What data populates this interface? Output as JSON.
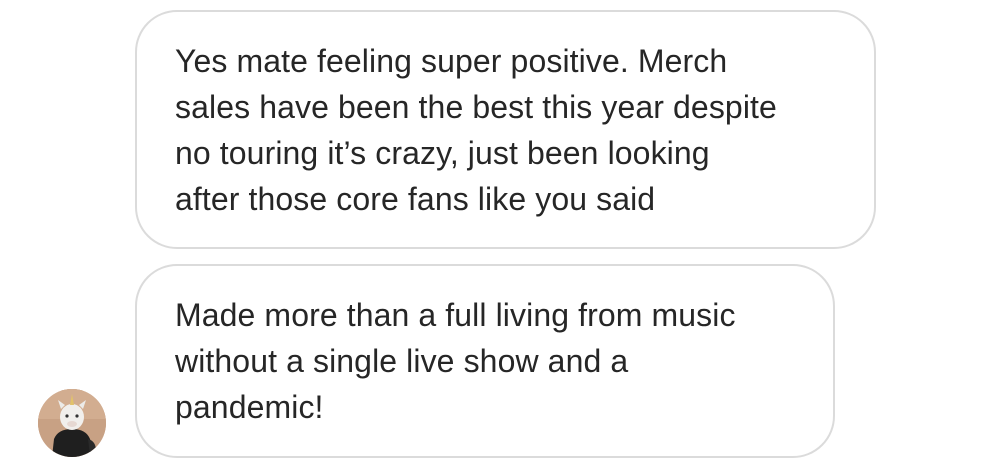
{
  "messages": [
    {
      "lines": [
        "Yes mate feeling super positive. Merch",
        "sales have been the best this year despite",
        "no touring it’s crazy, just been looking",
        "after those core fans like you said"
      ]
    },
    {
      "lines": [
        "Made more than a full living from music",
        "without a single live show and a",
        "pandemic!"
      ]
    }
  ],
  "sender": {
    "avatar_icon": "unicorn-mask-avatar-icon"
  },
  "colors": {
    "bubble_border": "#dbdbdb",
    "text": "#262626",
    "background": "#ffffff"
  }
}
